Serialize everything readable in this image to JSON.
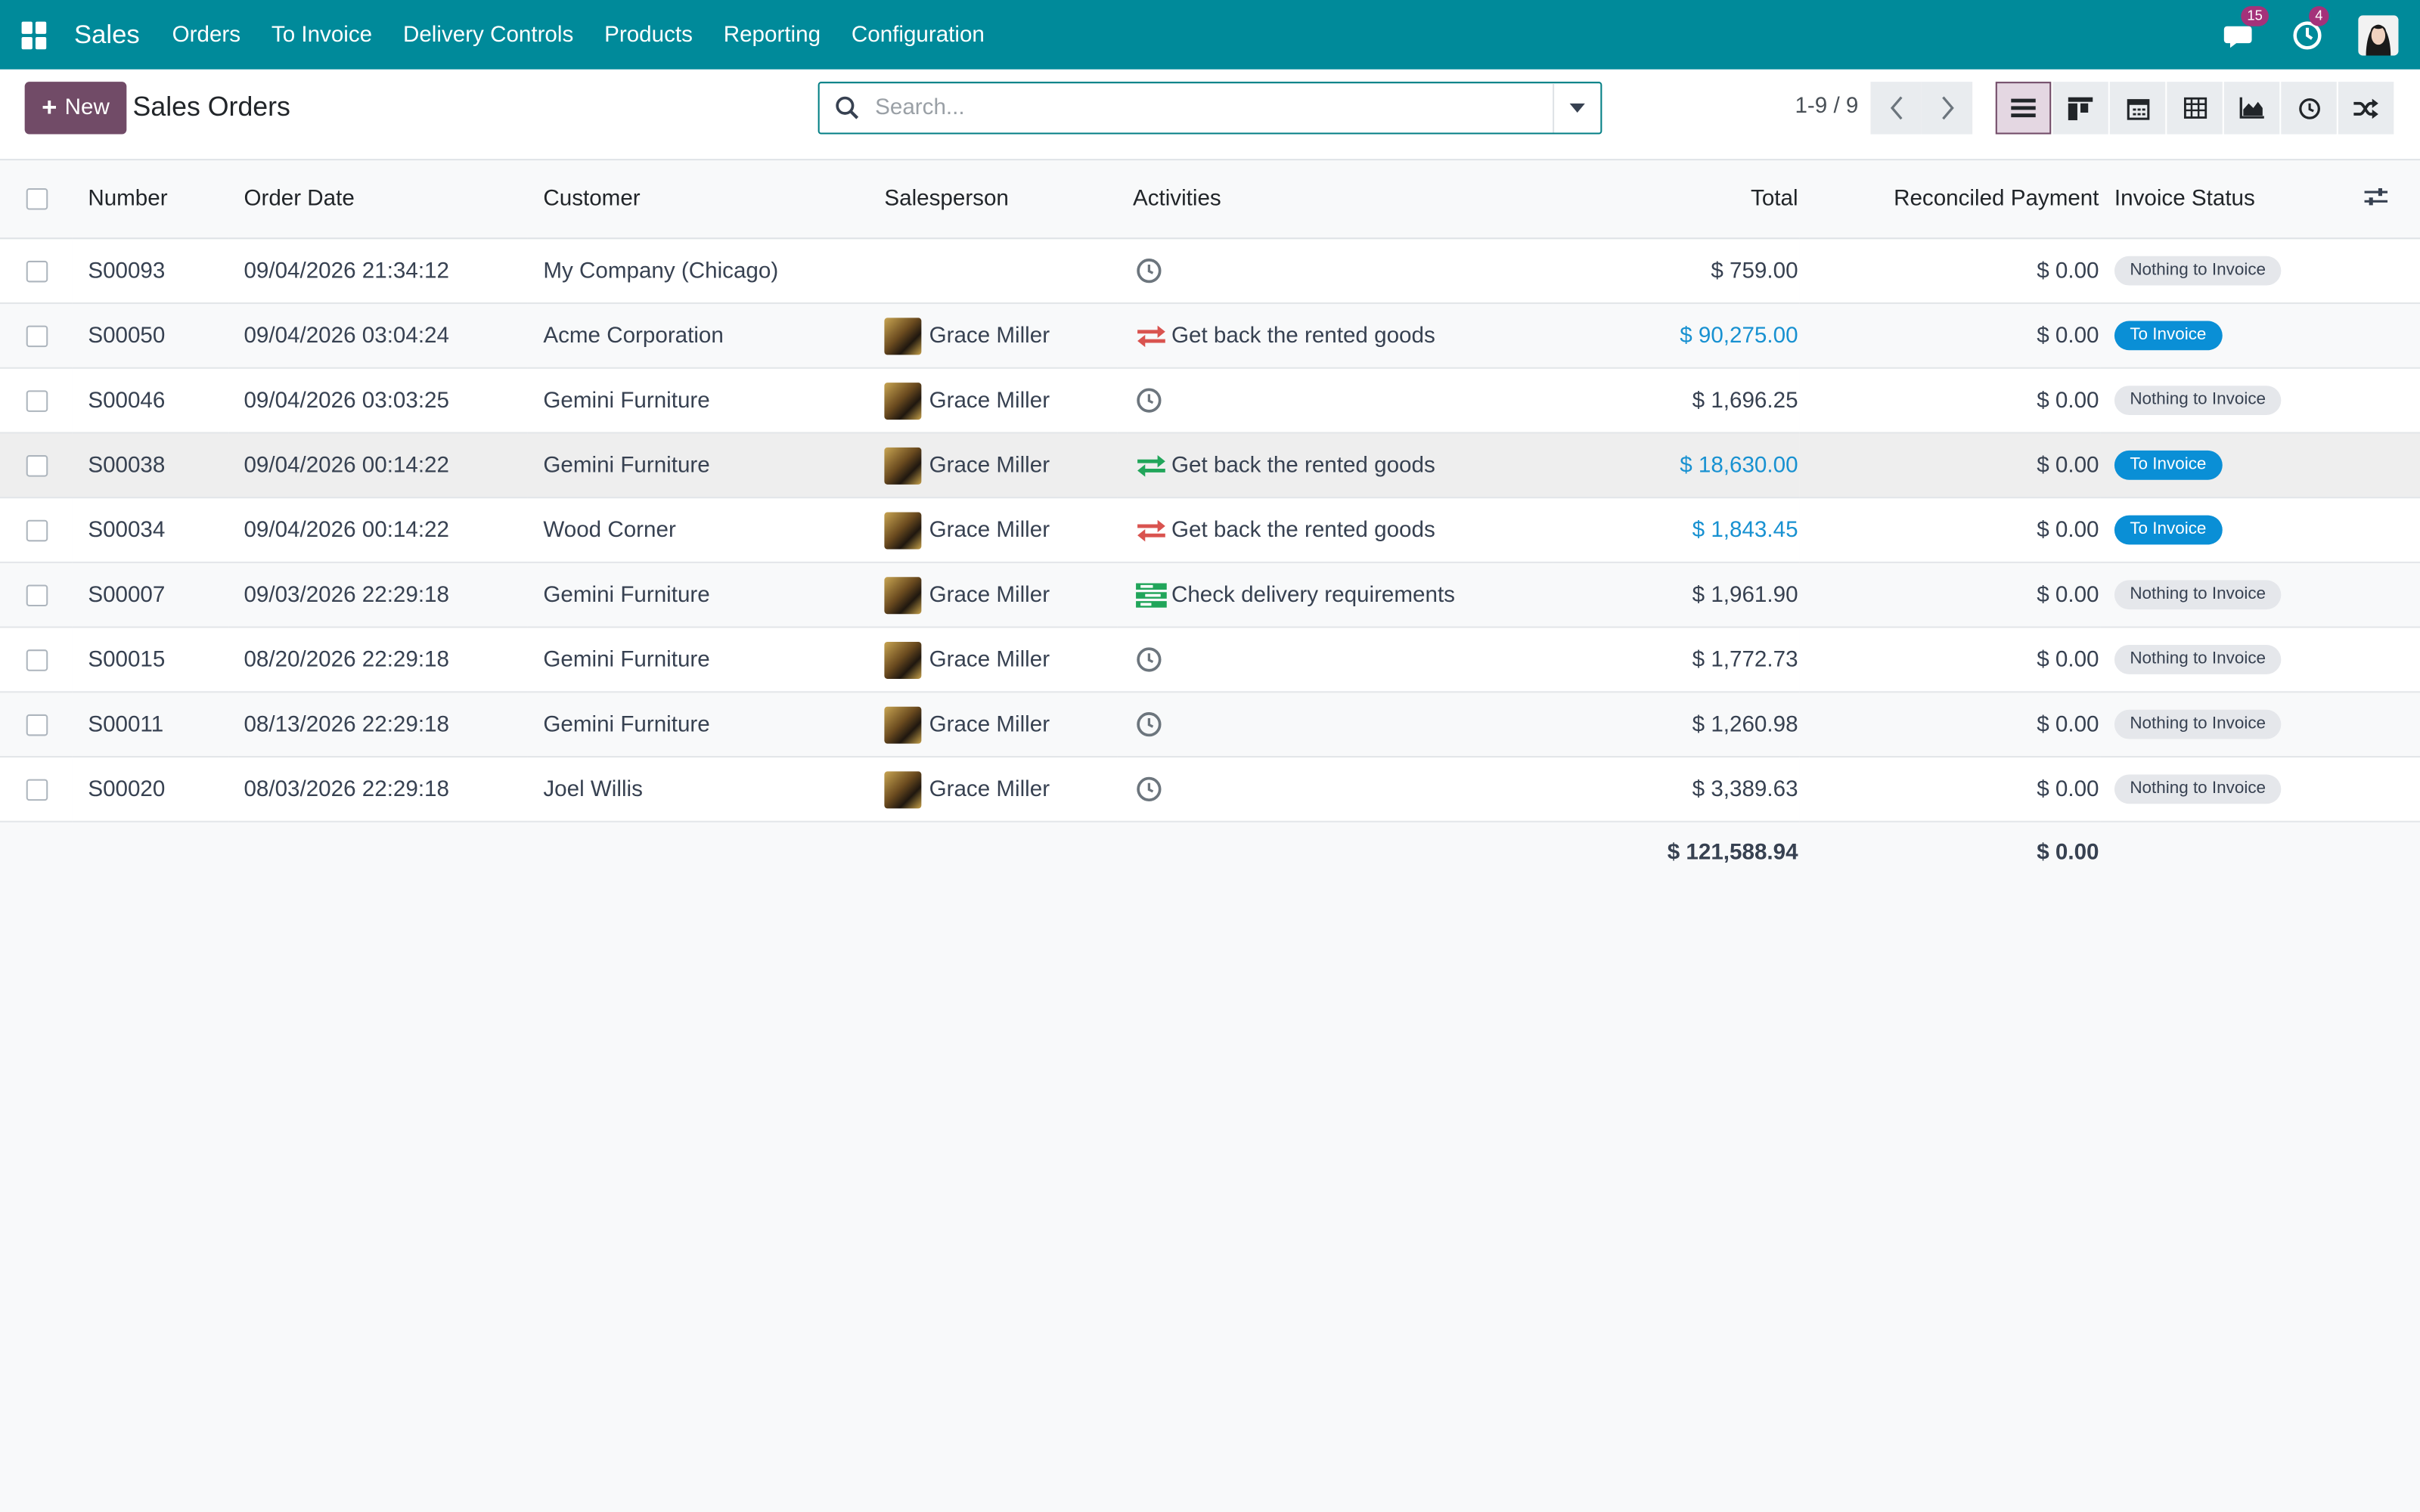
{
  "navbar": {
    "app_name": "Sales",
    "menu": [
      "Orders",
      "To Invoice",
      "Delivery Controls",
      "Products",
      "Reporting",
      "Configuration"
    ],
    "messages_count": "15",
    "activities_count": "4"
  },
  "control_panel": {
    "new_label": "New",
    "title": "Sales Orders",
    "search_placeholder": "Search...",
    "pager": "1-9 / 9"
  },
  "table": {
    "columns": [
      "Number",
      "Order Date",
      "Customer",
      "Salesperson",
      "Activities",
      "Total",
      "Reconciled Payment",
      "Invoice Status"
    ],
    "rows": [
      {
        "number": "S00093",
        "date": "09/04/2026 21:34:12",
        "customer": "My Company (Chicago)",
        "salesperson": "",
        "activity_icon": "clock-icon",
        "activity": "",
        "total": "$ 759.00",
        "total_link": false,
        "reconciled": "$ 0.00",
        "status": "Nothing to Invoice",
        "status_type": "grey"
      },
      {
        "number": "S00050",
        "date": "09/04/2026 03:04:24",
        "customer": "Acme Corporation",
        "salesperson": "Grace Miller",
        "activity_icon": "exchange-red-icon",
        "activity": "Get back the rented goods",
        "total": "$ 90,275.00",
        "total_link": true,
        "reconciled": "$ 0.00",
        "status": "To Invoice",
        "status_type": "blue"
      },
      {
        "number": "S00046",
        "date": "09/04/2026 03:03:25",
        "customer": "Gemini Furniture",
        "salesperson": "Grace Miller",
        "activity_icon": "clock-icon",
        "activity": "",
        "total": "$ 1,696.25",
        "total_link": false,
        "reconciled": "$ 0.00",
        "status": "Nothing to Invoice",
        "status_type": "grey"
      },
      {
        "number": "S00038",
        "date": "09/04/2026 00:14:22",
        "customer": "Gemini Furniture",
        "salesperson": "Grace Miller",
        "activity_icon": "exchange-green-icon",
        "activity": "Get back the rented goods",
        "total": "$ 18,630.00",
        "total_link": true,
        "reconciled": "$ 0.00",
        "status": "To Invoice",
        "status_type": "blue"
      },
      {
        "number": "S00034",
        "date": "09/04/2026 00:14:22",
        "customer": "Wood Corner",
        "salesperson": "Grace Miller",
        "activity_icon": "exchange-red-icon",
        "activity": "Get back the rented goods",
        "total": "$ 1,843.45",
        "total_link": true,
        "reconciled": "$ 0.00",
        "status": "To Invoice",
        "status_type": "blue"
      },
      {
        "number": "S00007",
        "date": "09/03/2026 22:29:18",
        "customer": "Gemini Furniture",
        "salesperson": "Grace Miller",
        "activity_icon": "tasks-green-icon",
        "activity": "Check delivery requirements",
        "total": "$ 1,961.90",
        "total_link": false,
        "reconciled": "$ 0.00",
        "status": "Nothing to Invoice",
        "status_type": "grey"
      },
      {
        "number": "S00015",
        "date": "08/20/2026 22:29:18",
        "customer": "Gemini Furniture",
        "salesperson": "Grace Miller",
        "activity_icon": "clock-icon",
        "activity": "",
        "total": "$ 1,772.73",
        "total_link": false,
        "reconciled": "$ 0.00",
        "status": "Nothing to Invoice",
        "status_type": "grey"
      },
      {
        "number": "S00011",
        "date": "08/13/2026 22:29:18",
        "customer": "Gemini Furniture",
        "salesperson": "Grace Miller",
        "activity_icon": "clock-icon",
        "activity": "",
        "total": "$ 1,260.98",
        "total_link": false,
        "reconciled": "$ 0.00",
        "status": "Nothing to Invoice",
        "status_type": "grey"
      },
      {
        "number": "S00020",
        "date": "08/03/2026 22:29:18",
        "customer": "Joel Willis",
        "salesperson": "Grace Miller",
        "activity_icon": "clock-icon",
        "activity": "",
        "total": "$ 3,389.63",
        "total_link": false,
        "reconciled": "$ 0.00",
        "status": "Nothing to Invoice",
        "status_type": "grey"
      }
    ],
    "footer": {
      "total": "$ 121,588.94",
      "reconciled": "$ 0.00"
    }
  },
  "colors": {
    "navbar": "#008a9a",
    "primary": "#714b67",
    "link": "#1891d1",
    "to_invoice": "#0a8fd6"
  }
}
